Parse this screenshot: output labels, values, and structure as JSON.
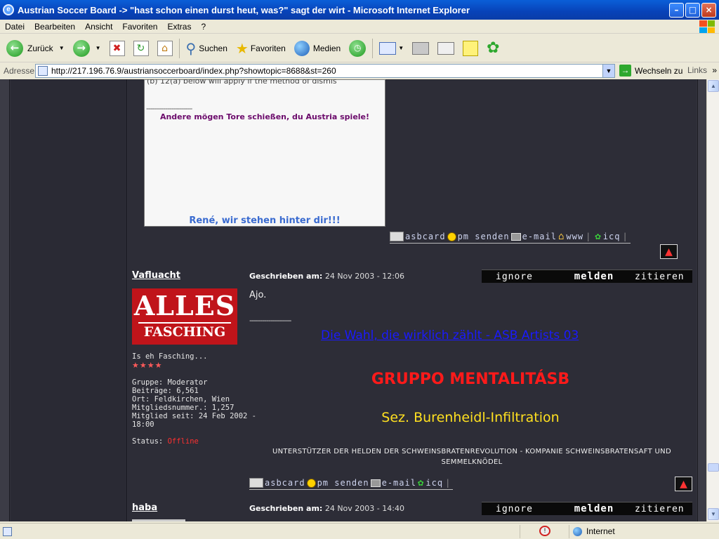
{
  "window": {
    "title": "Austrian Soccer Board -> \"hast schon einen durst heut, was?\" sagt der wirt - Microsoft Internet Explorer",
    "minimize_glyph": "–",
    "maximize_glyph": "□",
    "close_glyph": "×"
  },
  "menu": {
    "items": [
      "Datei",
      "Bearbeiten",
      "Ansicht",
      "Favoriten",
      "Extras",
      "?"
    ]
  },
  "toolbar": {
    "back_label": "Zurück",
    "search_label": "Suchen",
    "favorites_label": "Favoriten",
    "media_label": "Medien"
  },
  "address": {
    "label": "Adresse",
    "url": "http://217.196.76.9/austriansoccerboard/index.php?showtopic=8688&st=260",
    "go_label": "Wechseln zu",
    "links_label": "Links"
  },
  "post1": {
    "sig_cut_text": "(b) 12(a) below will apply if the method of dismis",
    "sig_dashes": "----------------------",
    "sig_motto": "Andere mögen Tore schießen, du Austria spiele!",
    "sig_rene": "René, wir stehen hinter dir!!!",
    "buttons": {
      "card": "asbcard",
      "pm": "pm senden",
      "mail": "e-mail",
      "www": "www",
      "icq": "icq"
    }
  },
  "post2": {
    "author": "Vafluacht",
    "written_label": "Geschrieben am:",
    "written_date": "24 Nov 2003 - 12:06",
    "actions": {
      "ignore": "ignore",
      "report": "melden",
      "quote": "zitieren"
    },
    "avatar_line1": "ALLES",
    "avatar_line2": "FASCHING",
    "user_title": "Is eh Fasching...",
    "stars": "★★★★",
    "group": "Gruppe: Moderator",
    "posts": "Beiträge: 6,561",
    "location": "Ort: Feldkirchen, Wien",
    "member_no": "Mitgliedsnummer.: 1,257",
    "member_since_1": "Mitglied seit: 24 Feb 2002 -",
    "member_since_2": "18:00",
    "status_label": "Status:",
    "status_value": "Offline",
    "text": "Ajo.",
    "dashes": "--------------------",
    "link_text": "Die Wahl, die wirklich zählt - ASB Artists 03",
    "gruppo": "GRUPPO MENTALITÁSB",
    "sez": "Sez. Burenheidl-Infiltration",
    "unterstuetzer": "UNTERSTÜTZER DER HELDEN DER SCHWEINSBRATENREVOLUTION - KOMPANIE SCHWEINSBRATENSAFT UND SEMMELKNÖDEL",
    "buttons": {
      "card": "asbcard",
      "pm": "pm senden",
      "mail": "e-mail",
      "icq": "icq"
    }
  },
  "post3": {
    "author": "haba",
    "written_label": "Geschrieben am:",
    "written_date": "24 Nov 2003 - 14:40",
    "actions": {
      "ignore": "ignore",
      "report": "melden",
      "quote": "zitieren"
    }
  },
  "status": {
    "zone": "Internet"
  }
}
